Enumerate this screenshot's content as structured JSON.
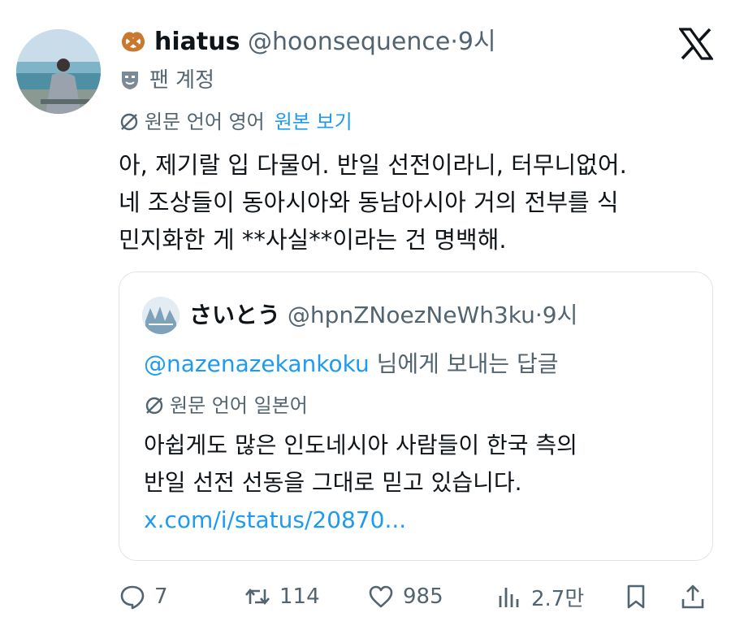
{
  "author": {
    "emoji_icon": "pretzel-emoji",
    "display_name": "hiatus",
    "handle": "@hoonsequence",
    "separator": "·",
    "time": "9시",
    "badge_label": "팬 계정"
  },
  "translation": {
    "source_language": "원문 언어 영어",
    "view_original_label": "원본 보기"
  },
  "tweet": {
    "text_lines": [
      "아, 제기랄 입 다물어. 반일 선전이라니, 터무니없어.",
      "네 조상들이 동아시아와 동남아시아 거의 전부를 식",
      "민지화한 게 **사실**이라는 건 명백해."
    ]
  },
  "quote": {
    "display_name": "さいとう",
    "handle": "@hpnZNoezNeWh3ku",
    "separator": "·",
    "time": "9시",
    "reply_mention": "@nazenazekankoku",
    "reply_suffix": "님에게 보내는 답글",
    "source_language": "원문 언어 일본어",
    "text_lines": [
      "아쉽게도 많은 인도네시아 사람들이 한국 측의",
      "반일 선전 선동을 그대로 믿고 있습니다."
    ],
    "link": "x.com/i/status/20870..."
  },
  "actions": {
    "replies": "7",
    "reposts": "114",
    "likes": "985",
    "views": "2.7만"
  },
  "colors": {
    "link_blue": "#1d9bf0",
    "secondary_text": "#536471",
    "primary_text": "#0f1419",
    "border": "#dfe3e6"
  }
}
